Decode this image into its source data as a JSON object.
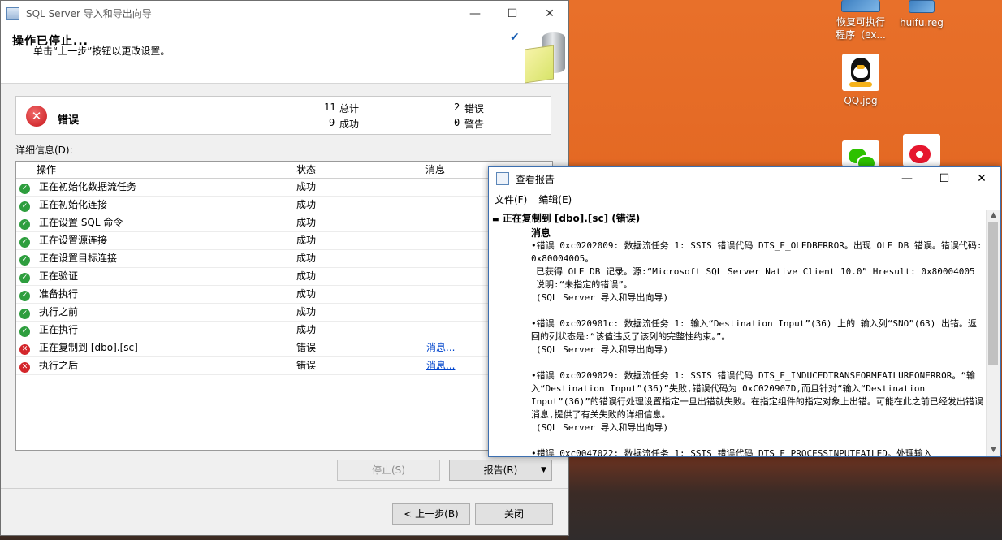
{
  "desktop": {
    "icons": [
      {
        "label": "恢复可执行\n程序（ex...",
        "icon": "reg-file-icon"
      },
      {
        "label": "huifu.reg",
        "icon": "reg-file-icon"
      },
      {
        "label": "QQ.jpg",
        "icon": "qq-icon"
      },
      {
        "label": "",
        "icon": "wechat-icon"
      },
      {
        "label": "",
        "icon": "weibo-icon"
      }
    ]
  },
  "wizard": {
    "title": "SQL Server 导入和导出向导",
    "heading": "操作已停止...",
    "subheading": "单击“上一步”按钮以更改设置。",
    "summary": {
      "status": "错误",
      "total_count": "11",
      "total_label": "总计",
      "success_count": "9",
      "success_label": "成功",
      "error_count": "2",
      "error_label": "错误",
      "warning_count": "0",
      "warning_label": "警告"
    },
    "details_label": "详细信息(D):",
    "columns": [
      "操作",
      "状态",
      "消息"
    ],
    "rows": [
      {
        "action": "正在初始化数据流任务",
        "status": "成功",
        "message": "",
        "ok": true
      },
      {
        "action": "正在初始化连接",
        "status": "成功",
        "message": "",
        "ok": true
      },
      {
        "action": "正在设置 SQL 命令",
        "status": "成功",
        "message": "",
        "ok": true
      },
      {
        "action": "正在设置源连接",
        "status": "成功",
        "message": "",
        "ok": true
      },
      {
        "action": "正在设置目标连接",
        "status": "成功",
        "message": "",
        "ok": true
      },
      {
        "action": "正在验证",
        "status": "成功",
        "message": "",
        "ok": true
      },
      {
        "action": "准备执行",
        "status": "成功",
        "message": "",
        "ok": true
      },
      {
        "action": "执行之前",
        "status": "成功",
        "message": "",
        "ok": true
      },
      {
        "action": "正在执行",
        "status": "成功",
        "message": "",
        "ok": true
      },
      {
        "action": "正在复制到 [dbo].[sc]",
        "status": "错误",
        "message": "消息...",
        "ok": false
      },
      {
        "action": "执行之后",
        "status": "错误",
        "message": "消息...",
        "ok": false
      }
    ],
    "buttons": {
      "stop": "停止(S)",
      "report": "报告(R)",
      "back": "< 上一步(B)",
      "close": "关闭"
    }
  },
  "report": {
    "title": "查看报告",
    "menu": [
      "文件(F)",
      "编辑(E)"
    ],
    "section_title": "正在复制到 [dbo].[sc] (错误)",
    "subsection": "消息",
    "entries": [
      {
        "lines": [
          "错误 0xc0202009: 数据流任务 1: SSIS 错误代码 DTS_E_OLEDBERROR。出现 OLE DB 错误。错误代码: 0x80004005。",
          "已获得 OLE DB 记录。源:“Microsoft SQL Server Native Client 10.0” Hresult: 0x80004005 说明:“未指定的错误”。",
          "(SQL Server 导入和导出向导)"
        ]
      },
      {
        "lines": [
          "错误 0xc020901c: 数据流任务 1: 输入“Destination Input”(36) 上的 输入列“SNO”(63) 出错。返回的列状态是:“该值违反了该列的完整性约束。”。",
          "(SQL Server 导入和导出向导)"
        ]
      },
      {
        "lines": [
          "错误 0xc0209029: 数据流任务 1: SSIS 错误代码 DTS_E_INDUCEDTRANSFORMFAILUREONERROR。“输入“Destination Input”(36)”失败,错误代码为 0xC020907D,而且针对“输入“Destination Input”(36)”的错误行处理设置指定一旦出错就失败。在指定组件的指定对象上出错。可能在此之前已经发出错误消息,提供了有关失败的详细信息。",
          "(SQL Server 导入和导出向导)"
        ]
      },
      {
        "lines": [
          "错误 0xc0047022: 数据流任务 1: SSIS 错误代码 DTS_E_PROCESSINPUTFAILED。处理输入"
        ]
      }
    ]
  }
}
